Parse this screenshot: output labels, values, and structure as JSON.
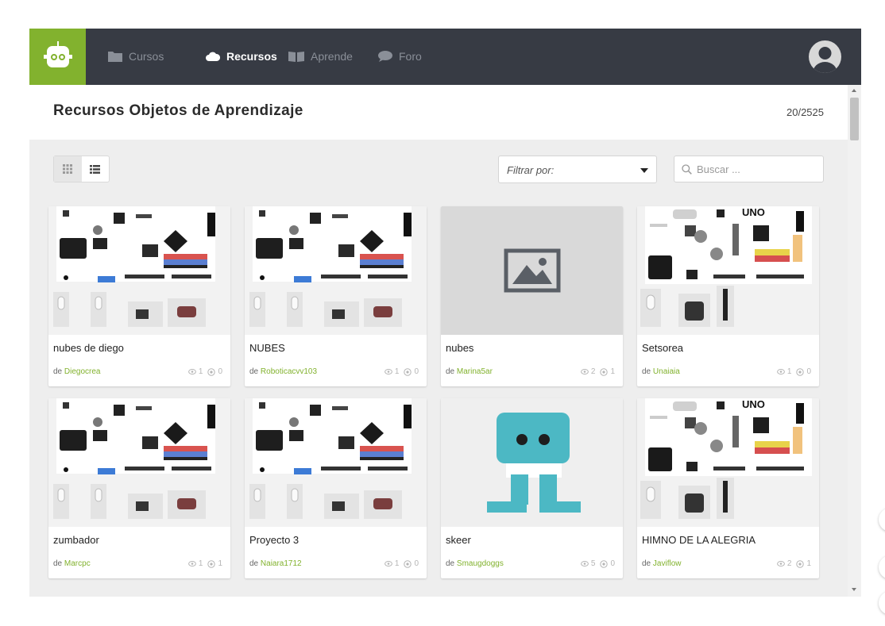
{
  "nav": {
    "items": [
      {
        "label": "Cursos",
        "icon": "folder-icon"
      },
      {
        "label": "Recursos",
        "icon": "cloud-icon",
        "active": true
      },
      {
        "label": "Aprende",
        "icon": "book-icon"
      },
      {
        "label": "Foro",
        "icon": "chat-bubble-icon"
      }
    ]
  },
  "header": {
    "title": "Recursos Objetos de Aprendizaje",
    "count": "20/2525"
  },
  "toolbar": {
    "filter_label": "Filtrar por:",
    "search_placeholder": "Buscar ..."
  },
  "cards": [
    {
      "title": "nubes de diego",
      "by": "de",
      "author": "Diegocrea",
      "views": "1",
      "copies": "0",
      "image": "board-zum"
    },
    {
      "title": "NUBES",
      "by": "de",
      "author": "Roboticacvv103",
      "views": "1",
      "copies": "0",
      "image": "board-zum"
    },
    {
      "title": "nubes",
      "by": "de",
      "author": "Marina5ar",
      "views": "2",
      "copies": "1",
      "image": "placeholder"
    },
    {
      "title": "Setsorea",
      "by": "de",
      "author": "Unaiaia",
      "views": "1",
      "copies": "0",
      "image": "board-freaduino"
    },
    {
      "title": "zumbador",
      "by": "de",
      "author": "Marcpc",
      "views": "1",
      "copies": "1",
      "image": "board-zum"
    },
    {
      "title": "Proyecto 3",
      "by": "de",
      "author": "Naiara1712",
      "views": "1",
      "copies": "0",
      "image": "board-zum"
    },
    {
      "title": "skeer",
      "by": "de",
      "author": "Smaugdoggs",
      "views": "5",
      "copies": "0",
      "image": "zowi-robot"
    },
    {
      "title": "HIMNO DE LA ALEGRIA",
      "by": "de",
      "author": "Javiflow",
      "views": "2",
      "copies": "1",
      "image": "board-freaduino"
    }
  ],
  "colors": {
    "brand_green": "#82b22e",
    "topbar": "#373b44",
    "content_bg": "#eeeeee",
    "zowi_blue": "#4cb8c4"
  }
}
